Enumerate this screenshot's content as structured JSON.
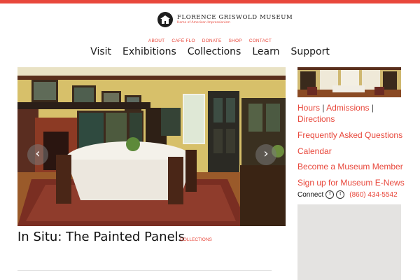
{
  "header": {
    "logo_name": "FLORENCE GRISWOLD MUSEUM",
    "logo_tagline": "Home of American Impressionism",
    "accent_color": "#e8473b"
  },
  "utility_nav": [
    "ABOUT",
    "CAFÉ FLO",
    "DONATE",
    "SHOP",
    "CONTACT"
  ],
  "main_nav": [
    "Visit",
    "Exhibitions",
    "Collections",
    "Learn",
    "Support"
  ],
  "carousel": {
    "prev_icon": "chevron-left-icon",
    "next_icon": "chevron-right-icon",
    "prev_glyph": "‹",
    "next_glyph": "›"
  },
  "post": {
    "title": "In Situ: The Painted Panels",
    "category": "COLLECTIONS"
  },
  "sidebar": {
    "hours": "Hours",
    "admissions": "Admissions",
    "directions": "Directions",
    "faq": "Frequently Asked Questions",
    "calendar": "Calendar",
    "member": "Become a Museum Member",
    "enews": "Sign up for Museum E-News",
    "connect_label": "Connect",
    "facebook_icon": "facebook-icon",
    "twitter_icon": "twitter-icon",
    "phone": "(860) 434-5542"
  }
}
